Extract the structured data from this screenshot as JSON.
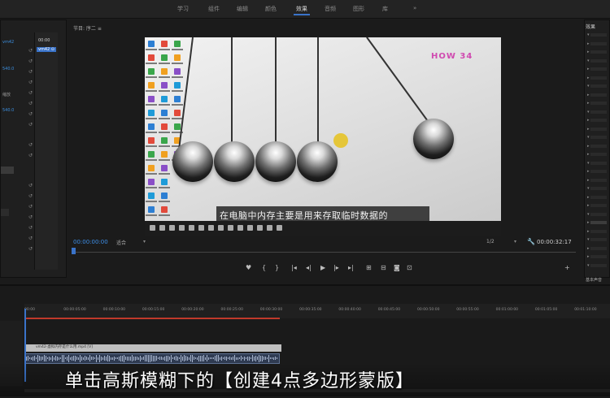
{
  "workspace_tabs": [
    "学习",
    "组件",
    "编辑",
    "颜色",
    "效果",
    "音频",
    "图形",
    "库"
  ],
  "workspace_more": "»",
  "active_workspace": "效果",
  "effect_controls": {
    "clip_name": "vm42",
    "clip_tab": "vm42 ⊙",
    "timecode": "00:00",
    "value_1": "540.0",
    "row_label": "缩放",
    "value_2": "540.0",
    "reset_glyph": "↺"
  },
  "program": {
    "title": "节目: 序二 ≡",
    "subtitle": "在电脑中内存主要是用来存取临时数据的",
    "logo_text": "HOW 34",
    "timecode_current": "00:00:00:00",
    "fit_label": "适合",
    "resolution_label": "1/2",
    "timecode_duration": "00:00:32:17",
    "controls": [
      "♥",
      "{",
      "}",
      "|◂",
      "◂|",
      "▶",
      "|▸",
      "▸|",
      "⊞",
      "⊟",
      "◙",
      "⊡"
    ],
    "add_button": "+"
  },
  "effects_panel": {
    "title": "效果",
    "footer": "基本声音"
  },
  "timeline": {
    "ticks": [
      "00:00",
      "00:00:05:00",
      "00:00:10:00",
      "00:00:15:00",
      "00:00:20:00",
      "00:00:25:00",
      "00:00:30:00",
      "00:00:35:00",
      "00:00:40:00",
      "00:00:45:00",
      "00:00:50:00",
      "00:00:55:00",
      "00:01:00:00",
      "00:01:05:00",
      "00:01:10:00"
    ],
    "video_clip_label": "vm42-虚拟内存是什么用.mp4 [V]",
    "audio_clip_label": "vm42-虚拟内存是什么用.mp4"
  },
  "caption": "单击高斯模糊下的【创建4点多边形蒙版】",
  "colors": {
    "accent_blue": "#3a73c9",
    "timecode_blue": "#3d8fe8",
    "work_area_red": "#c0392b",
    "cursor_highlight": "#e6c21c"
  }
}
